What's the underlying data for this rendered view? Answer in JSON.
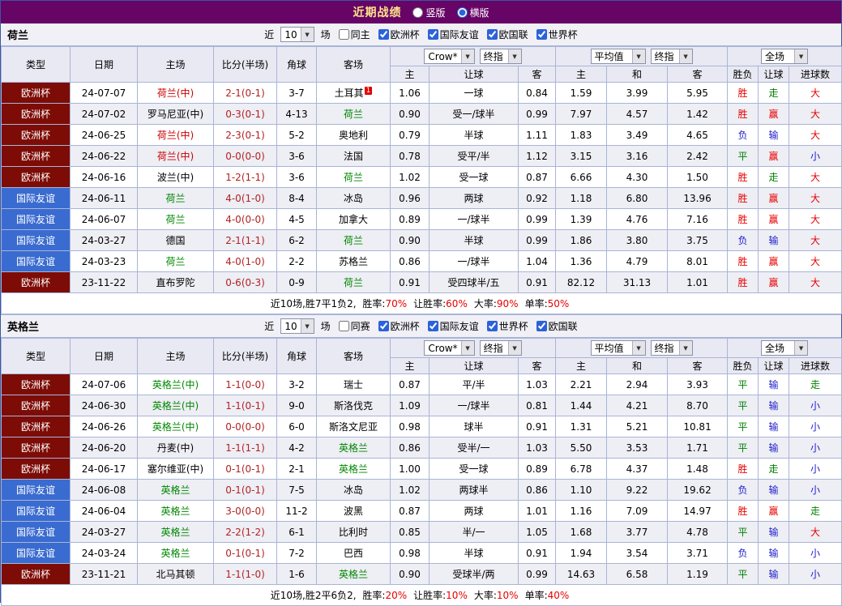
{
  "colors": {
    "title_bar_bg": "#660566",
    "title_text": "#ffe48a",
    "europe_cup_bg": "#7d0c06",
    "friendly_bg": "#3a6bd0",
    "grid_line": "#a9b5d6",
    "header_bg": "#e9e9f3",
    "row_alt_bg": "#eeeef5",
    "filter_bar_bg": "#f0f0f6",
    "result_red": "#e60000",
    "result_green": "#008000",
    "result_blue": "#2020cc",
    "score_text": "#b22222",
    "team_red": "#cc0000",
    "team_green": "#008800",
    "control_accent": "#2b62d9"
  },
  "header": {
    "title": "近期战绩",
    "radios": [
      {
        "label": "竖版",
        "selected": false
      },
      {
        "label": "横版",
        "selected": true
      }
    ]
  },
  "sections": [
    {
      "team": "荷兰",
      "filter": {
        "near_label": "近",
        "count": "10",
        "games_label": "场",
        "checkboxes": [
          {
            "label": "同主",
            "checked": false
          },
          {
            "label": "欧洲杯",
            "checked": true
          },
          {
            "label": "国际友谊",
            "checked": true
          },
          {
            "label": "欧国联",
            "checked": true
          },
          {
            "label": "世界杯",
            "checked": true
          }
        ]
      },
      "controls": {
        "bookmaker": "Crow*",
        "odds_stage": "终指",
        "average": "平均值",
        "average_stage": "终指",
        "scope": "全场"
      },
      "columns": [
        "类型",
        "日期",
        "主场",
        "比分(半场)",
        "角球",
        "客场",
        "主",
        "让球",
        "客",
        "主",
        "和",
        "客",
        "胜负",
        "让球",
        "进球数"
      ],
      "rows": [
        {
          "type": "欧洲杯",
          "tc": "euro",
          "date": "24-07-07",
          "home": {
            "text": "荷兰(中)",
            "cls": "t-red"
          },
          "score": "2-1(0-1)",
          "corner": "3-7",
          "away": {
            "text": "土耳其",
            "cls": "t-black",
            "badge": "1"
          },
          "odds": [
            "1.06",
            "一球",
            "0.84"
          ],
          "avg": [
            "1.59",
            "3.99",
            "5.95"
          ],
          "results": [
            {
              "t": "胜",
              "c": "r-red"
            },
            {
              "t": "走",
              "c": "r-green"
            },
            {
              "t": "大",
              "c": "r-red"
            }
          ]
        },
        {
          "type": "欧洲杯",
          "tc": "euro",
          "date": "24-07-02",
          "home": {
            "text": "罗马尼亚(中)",
            "cls": "t-black"
          },
          "score": "0-3(0-1)",
          "corner": "4-13",
          "away": {
            "text": "荷兰",
            "cls": "t-green"
          },
          "odds": [
            "0.90",
            "受一/球半",
            "0.99"
          ],
          "avg": [
            "7.97",
            "4.57",
            "1.42"
          ],
          "results": [
            {
              "t": "胜",
              "c": "r-red"
            },
            {
              "t": "赢",
              "c": "r-red"
            },
            {
              "t": "大",
              "c": "r-red"
            }
          ]
        },
        {
          "type": "欧洲杯",
          "tc": "euro",
          "date": "24-06-25",
          "home": {
            "text": "荷兰(中)",
            "cls": "t-red"
          },
          "score": "2-3(0-1)",
          "corner": "5-2",
          "away": {
            "text": "奥地利",
            "cls": "t-black"
          },
          "odds": [
            "0.79",
            "半球",
            "1.11"
          ],
          "avg": [
            "1.83",
            "3.49",
            "4.65"
          ],
          "results": [
            {
              "t": "负",
              "c": "r-blue"
            },
            {
              "t": "输",
              "c": "r-blue"
            },
            {
              "t": "大",
              "c": "r-red"
            }
          ]
        },
        {
          "type": "欧洲杯",
          "tc": "euro",
          "date": "24-06-22",
          "home": {
            "text": "荷兰(中)",
            "cls": "t-red"
          },
          "score": "0-0(0-0)",
          "corner": "3-6",
          "away": {
            "text": "法国",
            "cls": "t-black"
          },
          "odds": [
            "0.78",
            "受平/半",
            "1.12"
          ],
          "avg": [
            "3.15",
            "3.16",
            "2.42"
          ],
          "results": [
            {
              "t": "平",
              "c": "r-green"
            },
            {
              "t": "赢",
              "c": "r-red"
            },
            {
              "t": "小",
              "c": "r-blue"
            }
          ]
        },
        {
          "type": "欧洲杯",
          "tc": "euro",
          "date": "24-06-16",
          "home": {
            "text": "波兰(中)",
            "cls": "t-black"
          },
          "score": "1-2(1-1)",
          "corner": "3-6",
          "away": {
            "text": "荷兰",
            "cls": "t-green"
          },
          "odds": [
            "1.02",
            "受一球",
            "0.87"
          ],
          "avg": [
            "6.66",
            "4.30",
            "1.50"
          ],
          "results": [
            {
              "t": "胜",
              "c": "r-red"
            },
            {
              "t": "走",
              "c": "r-green"
            },
            {
              "t": "大",
              "c": "r-red"
            }
          ]
        },
        {
          "type": "国际友谊",
          "tc": "friendly",
          "date": "24-06-11",
          "home": {
            "text": "荷兰",
            "cls": "t-green"
          },
          "score": "4-0(1-0)",
          "corner": "8-4",
          "away": {
            "text": "冰岛",
            "cls": "t-black"
          },
          "odds": [
            "0.96",
            "两球",
            "0.92"
          ],
          "avg": [
            "1.18",
            "6.80",
            "13.96"
          ],
          "results": [
            {
              "t": "胜",
              "c": "r-red"
            },
            {
              "t": "赢",
              "c": "r-red"
            },
            {
              "t": "大",
              "c": "r-red"
            }
          ]
        },
        {
          "type": "国际友谊",
          "tc": "friendly",
          "date": "24-06-07",
          "home": {
            "text": "荷兰",
            "cls": "t-green"
          },
          "score": "4-0(0-0)",
          "corner": "4-5",
          "away": {
            "text": "加拿大",
            "cls": "t-black"
          },
          "odds": [
            "0.89",
            "一/球半",
            "0.99"
          ],
          "avg": [
            "1.39",
            "4.76",
            "7.16"
          ],
          "results": [
            {
              "t": "胜",
              "c": "r-red"
            },
            {
              "t": "赢",
              "c": "r-red"
            },
            {
              "t": "大",
              "c": "r-red"
            }
          ]
        },
        {
          "type": "国际友谊",
          "tc": "friendly",
          "date": "24-03-27",
          "home": {
            "text": "德国",
            "cls": "t-black"
          },
          "score": "2-1(1-1)",
          "corner": "6-2",
          "away": {
            "text": "荷兰",
            "cls": "t-green"
          },
          "odds": [
            "0.90",
            "半球",
            "0.99"
          ],
          "avg": [
            "1.86",
            "3.80",
            "3.75"
          ],
          "results": [
            {
              "t": "负",
              "c": "r-blue"
            },
            {
              "t": "输",
              "c": "r-blue"
            },
            {
              "t": "大",
              "c": "r-red"
            }
          ]
        },
        {
          "type": "国际友谊",
          "tc": "friendly",
          "date": "24-03-23",
          "home": {
            "text": "荷兰",
            "cls": "t-green"
          },
          "score": "4-0(1-0)",
          "corner": "2-2",
          "away": {
            "text": "苏格兰",
            "cls": "t-black"
          },
          "odds": [
            "0.86",
            "一/球半",
            "1.04"
          ],
          "avg": [
            "1.36",
            "4.79",
            "8.01"
          ],
          "results": [
            {
              "t": "胜",
              "c": "r-red"
            },
            {
              "t": "赢",
              "c": "r-red"
            },
            {
              "t": "大",
              "c": "r-red"
            }
          ]
        },
        {
          "type": "欧洲杯",
          "tc": "euro",
          "date": "23-11-22",
          "home": {
            "text": "直布罗陀",
            "cls": "t-black"
          },
          "score": "0-6(0-3)",
          "corner": "0-9",
          "away": {
            "text": "荷兰",
            "cls": "t-green"
          },
          "odds": [
            "0.91",
            "受四球半/五",
            "0.91"
          ],
          "avg": [
            "82.12",
            "31.13",
            "1.01"
          ],
          "results": [
            {
              "t": "胜",
              "c": "r-red"
            },
            {
              "t": "赢",
              "c": "r-red"
            },
            {
              "t": "大",
              "c": "r-red"
            }
          ]
        }
      ],
      "summary": {
        "lead": "近10场,胜7平1负2,",
        "stats": [
          {
            "label": "胜率:",
            "value": "70%"
          },
          {
            "label": "让胜率:",
            "value": "60%"
          },
          {
            "label": "大率:",
            "value": "90%"
          },
          {
            "label": "单率:",
            "value": "50%"
          }
        ]
      }
    },
    {
      "team": "英格兰",
      "filter": {
        "near_label": "近",
        "count": "10",
        "games_label": "场",
        "checkboxes": [
          {
            "label": "同赛",
            "checked": false
          },
          {
            "label": "欧洲杯",
            "checked": true
          },
          {
            "label": "国际友谊",
            "checked": true
          },
          {
            "label": "世界杯",
            "checked": true
          },
          {
            "label": "欧国联",
            "checked": true
          }
        ]
      },
      "controls": {
        "bookmaker": "Crow*",
        "odds_stage": "终指",
        "average": "平均值",
        "average_stage": "终指",
        "scope": "全场"
      },
      "columns": [
        "类型",
        "日期",
        "主场",
        "比分(半场)",
        "角球",
        "客场",
        "主",
        "让球",
        "客",
        "主",
        "和",
        "客",
        "胜负",
        "让球",
        "进球数"
      ],
      "rows": [
        {
          "type": "欧洲杯",
          "tc": "euro",
          "date": "24-07-06",
          "home": {
            "text": "英格兰(中)",
            "cls": "t-green"
          },
          "score": "1-1(0-0)",
          "corner": "3-2",
          "away": {
            "text": "瑞士",
            "cls": "t-black"
          },
          "odds": [
            "0.87",
            "平/半",
            "1.03"
          ],
          "avg": [
            "2.21",
            "2.94",
            "3.93"
          ],
          "results": [
            {
              "t": "平",
              "c": "r-green"
            },
            {
              "t": "输",
              "c": "r-blue"
            },
            {
              "t": "走",
              "c": "r-green"
            }
          ]
        },
        {
          "type": "欧洲杯",
          "tc": "euro",
          "date": "24-06-30",
          "home": {
            "text": "英格兰(中)",
            "cls": "t-green"
          },
          "score": "1-1(0-1)",
          "corner": "9-0",
          "away": {
            "text": "斯洛伐克",
            "cls": "t-black"
          },
          "odds": [
            "1.09",
            "一/球半",
            "0.81"
          ],
          "avg": [
            "1.44",
            "4.21",
            "8.70"
          ],
          "results": [
            {
              "t": "平",
              "c": "r-green"
            },
            {
              "t": "输",
              "c": "r-blue"
            },
            {
              "t": "小",
              "c": "r-blue"
            }
          ]
        },
        {
          "type": "欧洲杯",
          "tc": "euro",
          "date": "24-06-26",
          "home": {
            "text": "英格兰(中)",
            "cls": "t-green"
          },
          "score": "0-0(0-0)",
          "corner": "6-0",
          "away": {
            "text": "斯洛文尼亚",
            "cls": "t-black"
          },
          "odds": [
            "0.98",
            "球半",
            "0.91"
          ],
          "avg": [
            "1.31",
            "5.21",
            "10.81"
          ],
          "results": [
            {
              "t": "平",
              "c": "r-green"
            },
            {
              "t": "输",
              "c": "r-blue"
            },
            {
              "t": "小",
              "c": "r-blue"
            }
          ]
        },
        {
          "type": "欧洲杯",
          "tc": "euro",
          "date": "24-06-20",
          "home": {
            "text": "丹麦(中)",
            "cls": "t-black"
          },
          "score": "1-1(1-1)",
          "corner": "4-2",
          "away": {
            "text": "英格兰",
            "cls": "t-green"
          },
          "odds": [
            "0.86",
            "受半/一",
            "1.03"
          ],
          "avg": [
            "5.50",
            "3.53",
            "1.71"
          ],
          "results": [
            {
              "t": "平",
              "c": "r-green"
            },
            {
              "t": "输",
              "c": "r-blue"
            },
            {
              "t": "小",
              "c": "r-blue"
            }
          ]
        },
        {
          "type": "欧洲杯",
          "tc": "euro",
          "date": "24-06-17",
          "home": {
            "text": "塞尔维亚(中)",
            "cls": "t-black"
          },
          "score": "0-1(0-1)",
          "corner": "2-1",
          "away": {
            "text": "英格兰",
            "cls": "t-green"
          },
          "odds": [
            "1.00",
            "受一球",
            "0.89"
          ],
          "avg": [
            "6.78",
            "4.37",
            "1.48"
          ],
          "results": [
            {
              "t": "胜",
              "c": "r-red"
            },
            {
              "t": "走",
              "c": "r-green"
            },
            {
              "t": "小",
              "c": "r-blue"
            }
          ]
        },
        {
          "type": "国际友谊",
          "tc": "friendly",
          "date": "24-06-08",
          "home": {
            "text": "英格兰",
            "cls": "t-green"
          },
          "score": "0-1(0-1)",
          "corner": "7-5",
          "away": {
            "text": "冰岛",
            "cls": "t-black"
          },
          "odds": [
            "1.02",
            "两球半",
            "0.86"
          ],
          "avg": [
            "1.10",
            "9.22",
            "19.62"
          ],
          "results": [
            {
              "t": "负",
              "c": "r-blue"
            },
            {
              "t": "输",
              "c": "r-blue"
            },
            {
              "t": "小",
              "c": "r-blue"
            }
          ]
        },
        {
          "type": "国际友谊",
          "tc": "friendly",
          "date": "24-06-04",
          "home": {
            "text": "英格兰",
            "cls": "t-green"
          },
          "score": "3-0(0-0)",
          "corner": "11-2",
          "away": {
            "text": "波黑",
            "cls": "t-black"
          },
          "odds": [
            "0.87",
            "两球",
            "1.01"
          ],
          "avg": [
            "1.16",
            "7.09",
            "14.97"
          ],
          "results": [
            {
              "t": "胜",
              "c": "r-red"
            },
            {
              "t": "赢",
              "c": "r-red"
            },
            {
              "t": "走",
              "c": "r-green"
            }
          ]
        },
        {
          "type": "国际友谊",
          "tc": "friendly",
          "date": "24-03-27",
          "home": {
            "text": "英格兰",
            "cls": "t-green"
          },
          "score": "2-2(1-2)",
          "corner": "6-1",
          "away": {
            "text": "比利时",
            "cls": "t-black"
          },
          "odds": [
            "0.85",
            "半/一",
            "1.05"
          ],
          "avg": [
            "1.68",
            "3.77",
            "4.78"
          ],
          "results": [
            {
              "t": "平",
              "c": "r-green"
            },
            {
              "t": "输",
              "c": "r-blue"
            },
            {
              "t": "大",
              "c": "r-red"
            }
          ]
        },
        {
          "type": "国际友谊",
          "tc": "friendly",
          "date": "24-03-24",
          "home": {
            "text": "英格兰",
            "cls": "t-green"
          },
          "score": "0-1(0-1)",
          "corner": "7-2",
          "away": {
            "text": "巴西",
            "cls": "t-black"
          },
          "odds": [
            "0.98",
            "半球",
            "0.91"
          ],
          "avg": [
            "1.94",
            "3.54",
            "3.71"
          ],
          "results": [
            {
              "t": "负",
              "c": "r-blue"
            },
            {
              "t": "输",
              "c": "r-blue"
            },
            {
              "t": "小",
              "c": "r-blue"
            }
          ]
        },
        {
          "type": "欧洲杯",
          "tc": "euro",
          "date": "23-11-21",
          "home": {
            "text": "北马其顿",
            "cls": "t-black"
          },
          "score": "1-1(1-0)",
          "corner": "1-6",
          "away": {
            "text": "英格兰",
            "cls": "t-green"
          },
          "odds": [
            "0.90",
            "受球半/两",
            "0.99"
          ],
          "avg": [
            "14.63",
            "6.58",
            "1.19"
          ],
          "results": [
            {
              "t": "平",
              "c": "r-green"
            },
            {
              "t": "输",
              "c": "r-blue"
            },
            {
              "t": "小",
              "c": "r-blue"
            }
          ]
        }
      ],
      "summary": {
        "lead": "近10场,胜2平6负2,",
        "stats": [
          {
            "label": "胜率:",
            "value": "20%"
          },
          {
            "label": "让胜率:",
            "value": "10%"
          },
          {
            "label": "大率:",
            "value": "10%"
          },
          {
            "label": "单率:",
            "value": "40%"
          }
        ]
      }
    }
  ]
}
